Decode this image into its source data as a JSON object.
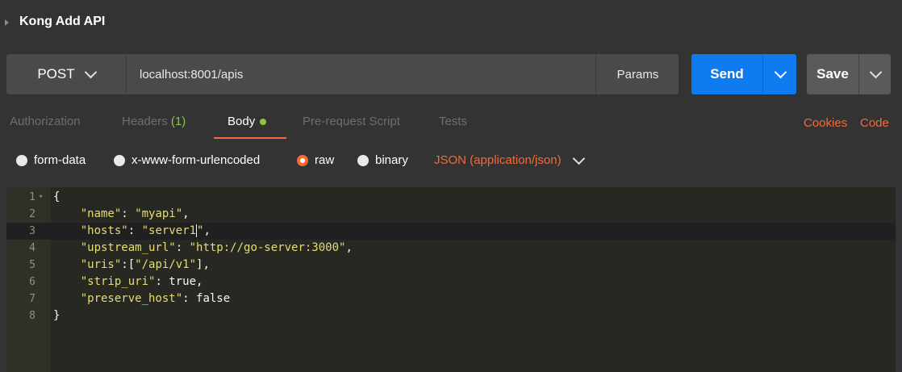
{
  "request": {
    "title": "Kong Add API"
  },
  "urlbar": {
    "method": "POST",
    "url": "localhost:8001/apis",
    "params_label": "Params"
  },
  "actions": {
    "send_label": "Send",
    "save_label": "Save"
  },
  "tabs": {
    "authorization": "Authorization",
    "headers": "Headers",
    "headers_count": "(1)",
    "body": "Body",
    "prerequest": "Pre-request Script",
    "tests": "Tests",
    "cookies": "Cookies",
    "code": "Code"
  },
  "body_options": {
    "form_data": "form-data",
    "urlencoded": "x-www-form-urlencoded",
    "raw": "raw",
    "binary": "binary",
    "content_type": "JSON (application/json)"
  },
  "editor": {
    "line_numbers": [
      "1",
      "2",
      "3",
      "4",
      "5",
      "6",
      "7",
      "8"
    ],
    "lines": {
      "l1": "{",
      "l2_key": "\"name\"",
      "l2_val": "\"myapi\"",
      "l3_key": "\"hosts\"",
      "l3_val_a": "\"server1",
      "l3_val_b": "\"",
      "l4_key": "\"upstream_url\"",
      "l4_val": "\"http://go-server:3000\"",
      "l5_key": "\"uris\"",
      "l5_val": "\"/api/v1\"",
      "l6_key": "\"strip_uri\"",
      "l6_val": "true",
      "l7_key": "\"preserve_host\"",
      "l7_val": "false",
      "l8": "}"
    }
  },
  "colors": {
    "accent_orange": "#f26b3a",
    "send_blue": "#0f7bf0",
    "status_green": "#8cc63f",
    "editor_bg": "#272822",
    "string_yellow": "#e6db74"
  },
  "icons": [
    "caret-right-icon",
    "chevron-down-icon",
    "radio-icon",
    "dot-icon"
  ]
}
